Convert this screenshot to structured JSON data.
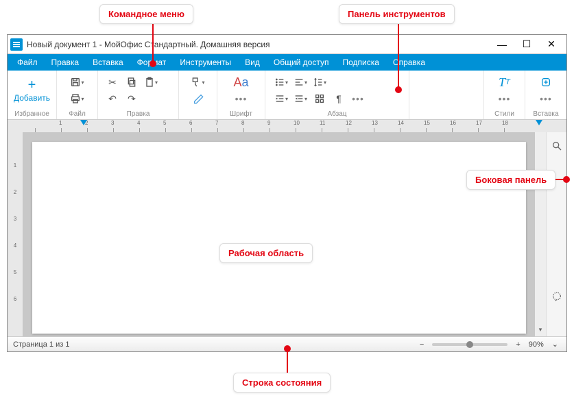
{
  "callouts": {
    "menu": "Командное меню",
    "toolbar": "Панель инструментов",
    "sidebar": "Боковая панель",
    "workspace": "Рабочая область",
    "statusbar": "Строка состояния"
  },
  "window": {
    "title": "Новый документ 1 - МойОфис Стандартный. Домашняя версия"
  },
  "menubar": [
    "Файл",
    "Правка",
    "Вставка",
    "Формат",
    "Инструменты",
    "Вид",
    "Общий доступ",
    "Подписка",
    "Справка"
  ],
  "ribbon": {
    "favorites": {
      "add": "Добавить",
      "label": "Избранное"
    },
    "file": {
      "label": "Файл"
    },
    "edit": {
      "label": "Правка"
    },
    "font": {
      "label": "Шрифт",
      "sample": "Aa"
    },
    "paragraph": {
      "label": "Абзац"
    },
    "styles": {
      "label": "Стили"
    },
    "insert": {
      "label": "Вставка"
    }
  },
  "ruler": {
    "marks": [
      "",
      "1",
      "2",
      "3",
      "4",
      "5",
      "6",
      "7",
      "8",
      "9",
      "10",
      "11",
      "12",
      "13",
      "14",
      "15",
      "16",
      "17",
      "18"
    ]
  },
  "vruler": [
    "",
    "1",
    "2",
    "3",
    "4",
    "5",
    "6"
  ],
  "status": {
    "page": "Страница 1 из 1",
    "zoom": "90%"
  },
  "icons": {
    "minimize": "—",
    "maximize": "☐",
    "close": "✕",
    "minus": "−",
    "plus": "+",
    "chevdown": "⌄"
  }
}
